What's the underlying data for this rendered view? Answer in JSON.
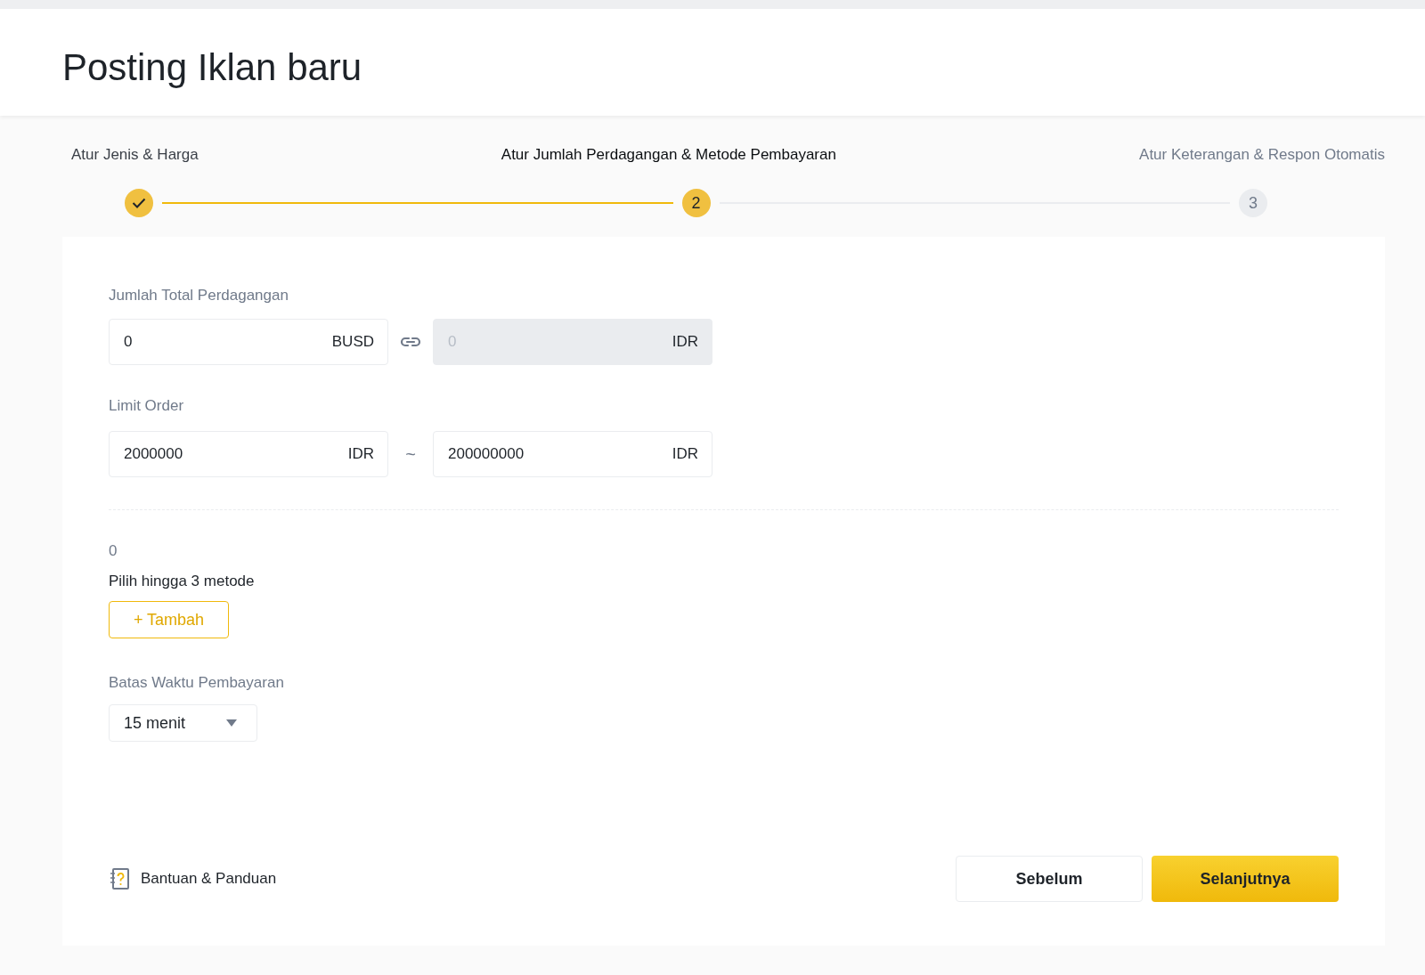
{
  "page_title": "Posting Iklan baru",
  "steps": [
    {
      "label": "Atur Jenis & Harga",
      "completed": true,
      "selected": false
    },
    {
      "label": "Atur Jumlah Perdagangan & Metode Pembayaran",
      "completed": false,
      "selected": true,
      "number": "2"
    },
    {
      "label": "Atur Keterangan & Respon Otomatis",
      "completed": false,
      "selected": false,
      "number": "3"
    }
  ],
  "total_amount": {
    "label": "Jumlah Total Perdagangan",
    "fields": [
      {
        "value": "0",
        "unit": "BUSD",
        "disabled": false
      },
      {
        "placeholder": "0",
        "unit": "IDR",
        "disabled": true
      }
    ]
  },
  "limit_order": {
    "label": "Limit Order",
    "separator": "~",
    "fields": [
      {
        "value": "2000000",
        "unit": "IDR",
        "disabled": false
      },
      {
        "value": "200000000",
        "unit": "IDR",
        "disabled": false
      }
    ]
  },
  "payment_methods": {
    "count": "0",
    "hint": "Pilih hingga 3 metode",
    "add_button": "+ Tambah"
  },
  "payment_time_limit": {
    "label": "Batas Waktu Pembayaran",
    "value": "15 menit"
  },
  "help_link": "Bantuan & Panduan",
  "buttons": [
    {
      "label": "Sebelum",
      "kind": "secondary"
    },
    {
      "label": "Selanjutnya",
      "kind": "primary"
    }
  ]
}
